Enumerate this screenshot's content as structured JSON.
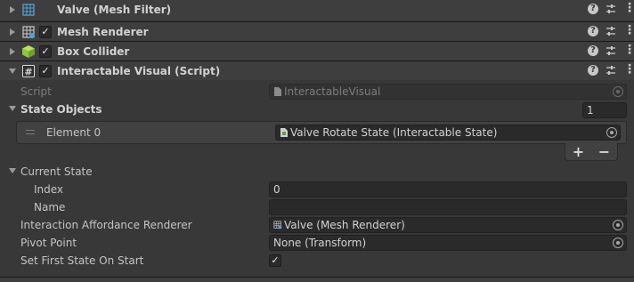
{
  "components": [
    {
      "title": "Valve (Mesh Filter)",
      "icon": "mesh-filter-icon",
      "has_toggle": false
    },
    {
      "title": "Mesh Renderer",
      "icon": "mesh-renderer-icon",
      "has_toggle": true
    },
    {
      "title": "Box Collider",
      "icon": "box-collider-icon",
      "has_toggle": true
    },
    {
      "title": "Interactable Visual (Script)",
      "icon": "script-icon",
      "has_toggle": true
    }
  ],
  "header_buttons": {
    "help": "?",
    "kebab": "⋮"
  },
  "toggle_mark": "✓",
  "script": {
    "label": "Script",
    "value": "InteractableVisual"
  },
  "state_objects": {
    "label": "State Objects",
    "size": "1",
    "elements": [
      {
        "label": "Element 0",
        "value": "Valve Rotate State (Interactable State)"
      }
    ],
    "add": "+",
    "remove": "−"
  },
  "current_state": {
    "label": "Current State",
    "index_label": "Index",
    "index_value": "0",
    "name_label": "Name",
    "name_value": ""
  },
  "affordance": {
    "label": "Interaction Affordance Renderer",
    "value": "Valve (Mesh Renderer)"
  },
  "pivot": {
    "label": "Pivot Point",
    "value": "None (Transform)"
  },
  "first_state": {
    "label": "Set First State On Start",
    "checked": "✓"
  },
  "colors": {
    "background": "#383838",
    "header": "#3e3e3e",
    "field": "#2a2a2a",
    "text": "#c4c4c4"
  }
}
